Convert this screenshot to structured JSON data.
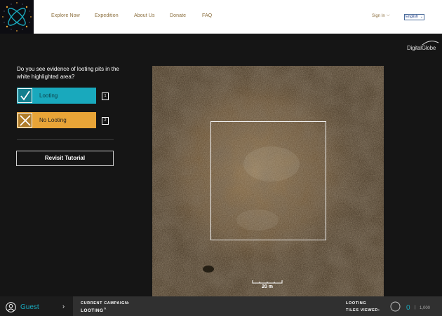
{
  "header": {
    "nav": [
      "Explore Now",
      "Expedition",
      "About Us",
      "Donate",
      "FAQ"
    ],
    "sign_in": "Sign In",
    "language": "English"
  },
  "task": {
    "question": "Do you see evidence of looting pits in the white highlighted area?",
    "answers": [
      {
        "label": "Looting",
        "hotkey": "1",
        "color": "#19a9bd",
        "icon": "check-icon"
      },
      {
        "label": "No Looting",
        "hotkey": "2",
        "color": "#e8a437",
        "icon": "x-icon"
      }
    ],
    "revisit_label": "Revisit Tutorial"
  },
  "imagery": {
    "provider": "DigitalGlobe",
    "scale_label": "20 m"
  },
  "footer": {
    "user": "Guest",
    "campaign_heading": "CURRENT CAMPAIGN:",
    "campaign_value": "LOOTING",
    "tiles_line1": "LOOTING",
    "tiles_line2": "TILES VIEWED:",
    "tiles_count": "0",
    "tiles_sep": "|",
    "tiles_total": "1,000",
    "progress_fraction": 0
  },
  "colors": {
    "accent": "#19a9bd",
    "warning": "#e8a437",
    "nav_text": "#8a6d3b"
  }
}
